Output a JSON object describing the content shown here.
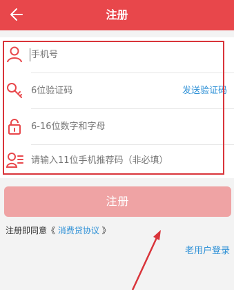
{
  "header": {
    "title": "注册",
    "back_icon": "back-arrow-icon",
    "color": "#e8474b"
  },
  "form": {
    "phone": {
      "placeholder": "手机号",
      "icon": "user-icon"
    },
    "code": {
      "placeholder": "6位验证码",
      "icon": "key-icon",
      "send_label": "发送验证码"
    },
    "password": {
      "placeholder": "6-16位数字和字母",
      "icon": "lock-icon"
    },
    "referrer": {
      "placeholder": "请输入11位手机推荐码（非必填）",
      "icon": "referrer-icon"
    }
  },
  "register_button": {
    "label": "注册"
  },
  "agreement": {
    "prefix": "注册即同意",
    "open": "《",
    "link": "消费贷协议",
    "close": "》"
  },
  "old_user_link": "老用户登录"
}
